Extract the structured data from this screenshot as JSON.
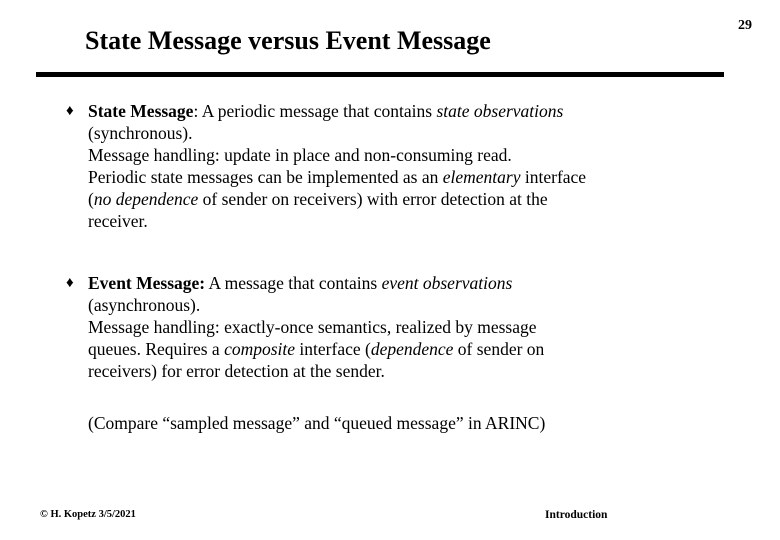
{
  "slide": {
    "page_number": "29",
    "title": "State Message versus Event Message",
    "bullet_glyph": "♦",
    "bullets": [
      {
        "lines": [
          {
            "segments": [
              {
                "text": "State Message",
                "style": "bold"
              },
              {
                "text": ":  A periodic message that contains ",
                "style": "normal"
              },
              {
                "text": "state observations",
                "style": "italic"
              }
            ]
          },
          {
            "segments": [
              {
                "text": "(synchronous).",
                "style": "normal"
              }
            ]
          },
          {
            "segments": [
              {
                "text": "Message  handling:  update in place and non-consuming read.",
                "style": "normal"
              }
            ]
          },
          {
            "segments": [
              {
                "text": "Periodic state messages can be implemented as an ",
                "style": "normal"
              },
              {
                "text": "elementary",
                "style": "italic"
              },
              {
                "text": " interface",
                "style": "normal"
              }
            ]
          },
          {
            "segments": [
              {
                "text": "(",
                "style": "normal"
              },
              {
                "text": "no dependence",
                "style": "italic"
              },
              {
                "text": " of sender on receivers) with error detection at the",
                "style": "normal"
              }
            ]
          },
          {
            "segments": [
              {
                "text": "receiver.",
                "style": "normal"
              }
            ]
          }
        ]
      },
      {
        "lines": [
          {
            "segments": [
              {
                "text": "Event Message:",
                "style": "bold"
              },
              {
                "text": "  A message that contains ",
                "style": "normal"
              },
              {
                "text": "event observations",
                "style": "italic"
              }
            ]
          },
          {
            "segments": [
              {
                "text": "(asynchronous).",
                "style": "normal"
              }
            ]
          },
          {
            "segments": [
              {
                "text": "Message handling:  exactly-once semantics, realized by message",
                "style": "normal"
              }
            ]
          },
          {
            "segments": [
              {
                "text": "queues. Requires a ",
                "style": "normal"
              },
              {
                "text": "composite",
                "style": "italic"
              },
              {
                "text": " interface (",
                "style": "normal"
              },
              {
                "text": "dependence",
                "style": "italic"
              },
              {
                "text": " of sender on",
                "style": "normal"
              }
            ]
          },
          {
            "segments": [
              {
                "text": "receivers) for error detection at the sender.",
                "style": "normal"
              }
            ]
          }
        ]
      }
    ],
    "note": "(Compare “sampled message” and “queued message”  in ARINC)",
    "footer": {
      "left": "© H. Kopetz  3/5/2021",
      "center": "Introduction"
    }
  }
}
